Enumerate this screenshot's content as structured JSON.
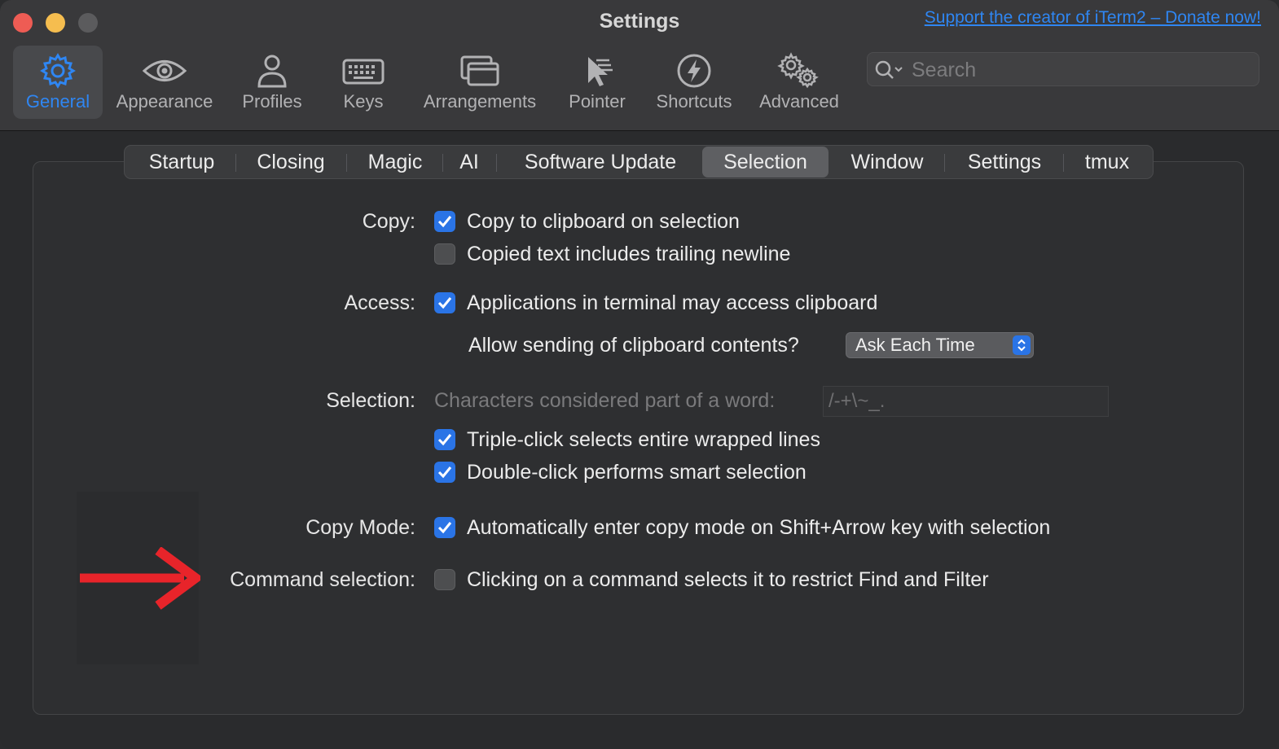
{
  "window": {
    "title": "Settings",
    "donate_link": "Support the creator of iTerm2 – Donate now!"
  },
  "toolbar": {
    "items": [
      {
        "label": "General",
        "icon": "gear-icon",
        "active": true
      },
      {
        "label": "Appearance",
        "icon": "eye-icon"
      },
      {
        "label": "Profiles",
        "icon": "person-icon"
      },
      {
        "label": "Keys",
        "icon": "keyboard-icon"
      },
      {
        "label": "Arrangements",
        "icon": "windows-icon"
      },
      {
        "label": "Pointer",
        "icon": "pointer-icon"
      },
      {
        "label": "Shortcuts",
        "icon": "bolt-icon"
      },
      {
        "label": "Advanced",
        "icon": "gears-icon"
      }
    ],
    "search_placeholder": "Search"
  },
  "tabs": [
    {
      "label": "Startup"
    },
    {
      "label": "Closing"
    },
    {
      "label": "Magic"
    },
    {
      "label": "AI"
    },
    {
      "label": "Software Update"
    },
    {
      "label": "Selection",
      "active": true
    },
    {
      "label": "Window"
    },
    {
      "label": "Settings"
    },
    {
      "label": "tmux"
    }
  ],
  "settings": {
    "copy": {
      "label": "Copy:",
      "copy_to_clipboard": {
        "text": "Copy to clipboard on selection",
        "checked": true
      },
      "trailing_newline": {
        "text": "Copied text includes trailing newline",
        "checked": false
      }
    },
    "access": {
      "label": "Access:",
      "apps_access_clipboard": {
        "text": "Applications in terminal may access clipboard",
        "checked": true
      },
      "allow_sending_label": "Allow sending of clipboard contents?",
      "allow_sending_value": "Ask Each Time"
    },
    "selection": {
      "label": "Selection:",
      "word_chars_label": "Characters considered part of a word:",
      "word_chars_value": "/-+\\~_.",
      "triple_click": {
        "text": "Triple-click selects entire wrapped lines",
        "checked": true
      },
      "double_click": {
        "text": "Double-click performs smart selection",
        "checked": true
      }
    },
    "copy_mode": {
      "label": "Copy Mode:",
      "auto_enter": {
        "text": "Automatically enter copy mode on Shift+Arrow key with selection",
        "checked": true
      }
    },
    "command_selection": {
      "label": "Command selection:",
      "clicking_selects": {
        "text": "Clicking on a command selects it to restrict Find and Filter",
        "checked": false
      }
    }
  },
  "colors": {
    "accent": "#2f86f2",
    "annotation_arrow": "#e8242a"
  }
}
